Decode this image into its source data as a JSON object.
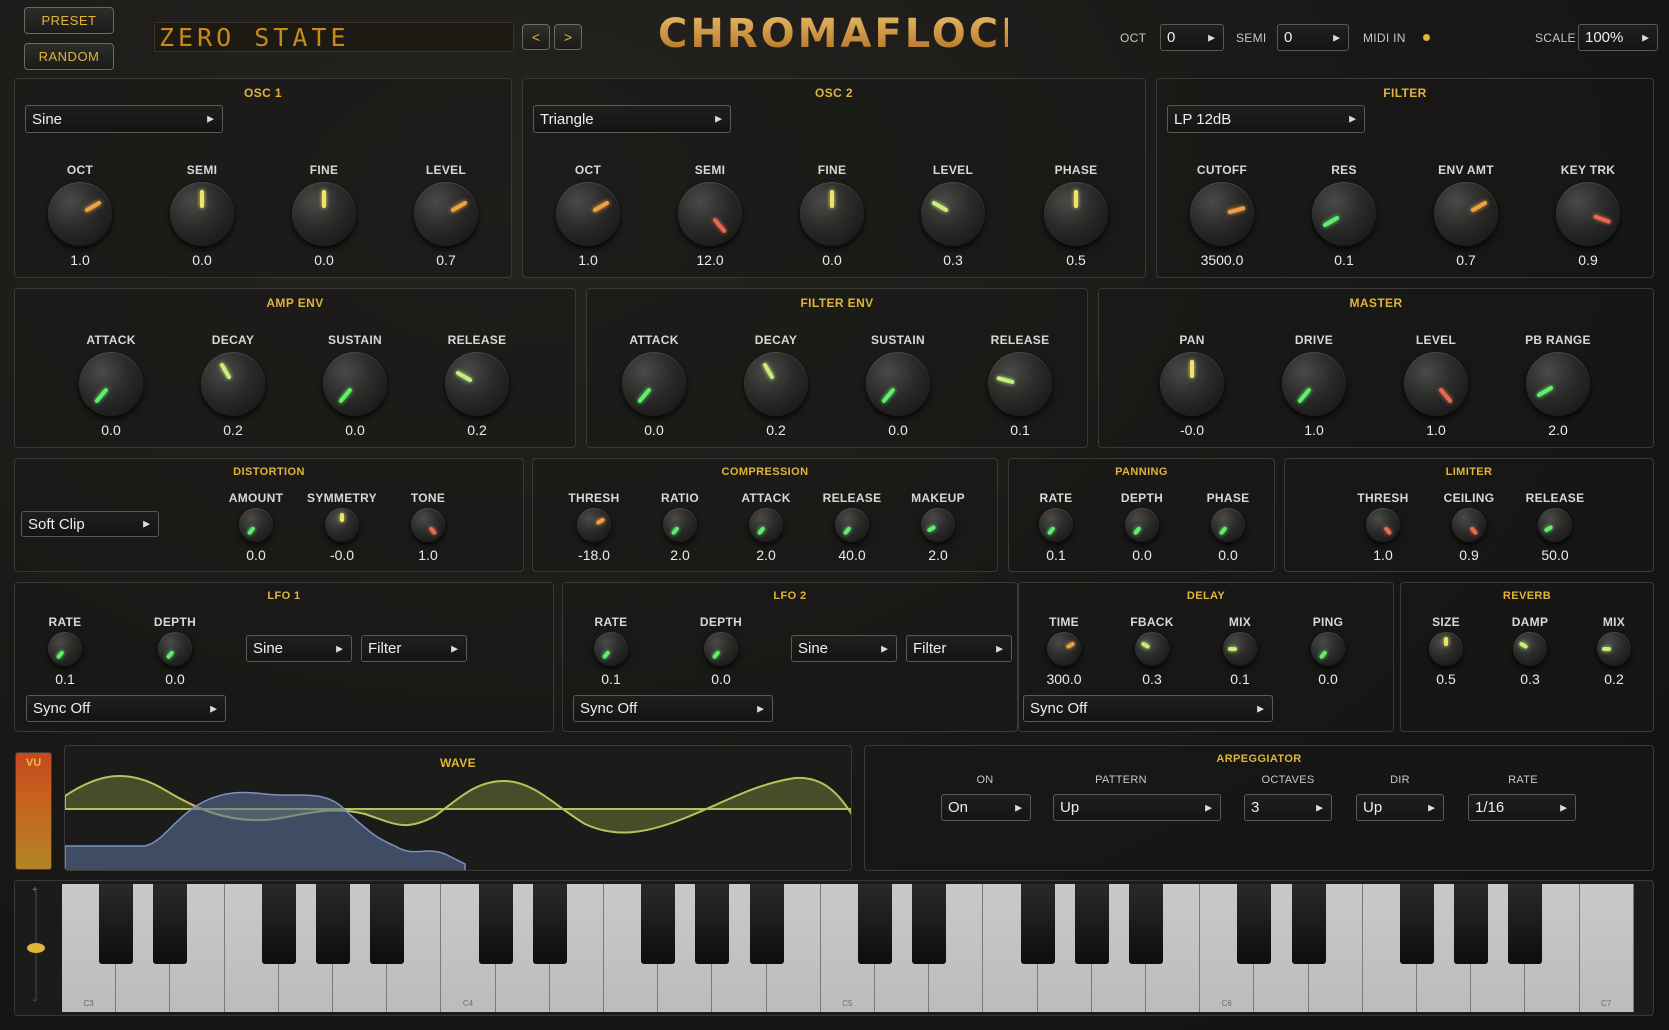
{
  "header": {
    "preset_label": "PRESET",
    "random_label": "RANDOM",
    "preset_name": "ZERO STATE",
    "prev_label": "<",
    "next_label": ">",
    "logo": "CHROMAFLOCK",
    "oct_label": "OCT",
    "oct_value": "0",
    "semi_label": "SEMI",
    "semi_value": "0",
    "midi_label": "MIDI IN",
    "scale_label": "SCALE",
    "scale_value": "100%"
  },
  "osc1": {
    "title": "OSC 1",
    "wave": "Sine",
    "knobs": [
      {
        "label": "OCT",
        "value": "1.0"
      },
      {
        "label": "SEMI",
        "value": "0.0"
      },
      {
        "label": "FINE",
        "value": "0.0"
      },
      {
        "label": "LEVEL",
        "value": "0.7"
      }
    ]
  },
  "osc2": {
    "title": "OSC 2",
    "wave": "Triangle",
    "knobs": [
      {
        "label": "OCT",
        "value": "1.0"
      },
      {
        "label": "SEMI",
        "value": "12.0"
      },
      {
        "label": "FINE",
        "value": "0.0"
      },
      {
        "label": "LEVEL",
        "value": "0.3"
      },
      {
        "label": "PHASE",
        "value": "0.5"
      }
    ]
  },
  "filter": {
    "title": "FILTER",
    "type": "LP 12dB",
    "knobs": [
      {
        "label": "CUTOFF",
        "value": "3500.0"
      },
      {
        "label": "RES",
        "value": "0.1"
      },
      {
        "label": "ENV AMT",
        "value": "0.7"
      },
      {
        "label": "KEY TRK",
        "value": "0.9"
      }
    ]
  },
  "ampenv": {
    "title": "AMP ENV",
    "knobs": [
      {
        "label": "ATTACK",
        "value": "0.0"
      },
      {
        "label": "DECAY",
        "value": "0.2"
      },
      {
        "label": "SUSTAIN",
        "value": "0.0"
      },
      {
        "label": "RELEASE",
        "value": "0.2"
      }
    ]
  },
  "filterenv": {
    "title": "FILTER ENV",
    "knobs": [
      {
        "label": "ATTACK",
        "value": "0.0"
      },
      {
        "label": "DECAY",
        "value": "0.2"
      },
      {
        "label": "SUSTAIN",
        "value": "0.0"
      },
      {
        "label": "RELEASE",
        "value": "0.1"
      }
    ]
  },
  "master": {
    "title": "MASTER",
    "knobs": [
      {
        "label": "PAN",
        "value": "-0.0"
      },
      {
        "label": "DRIVE",
        "value": "1.0"
      },
      {
        "label": "LEVEL",
        "value": "1.0"
      },
      {
        "label": "PB RANGE",
        "value": "2.0"
      }
    ]
  },
  "distortion": {
    "title": "DISTORTION",
    "type": "Soft Clip",
    "knobs": [
      {
        "label": "AMOUNT",
        "value": "0.0"
      },
      {
        "label": "SYMMETRY",
        "value": "-0.0"
      },
      {
        "label": "TONE",
        "value": "1.0"
      }
    ]
  },
  "compression": {
    "title": "COMPRESSION",
    "knobs": [
      {
        "label": "THRESH",
        "value": "-18.0"
      },
      {
        "label": "RATIO",
        "value": "2.0"
      },
      {
        "label": "ATTACK",
        "value": "2.0"
      },
      {
        "label": "RELEASE",
        "value": "40.0"
      },
      {
        "label": "MAKEUP",
        "value": "2.0"
      }
    ]
  },
  "panning": {
    "title": "PANNING",
    "knobs": [
      {
        "label": "RATE",
        "value": "0.1"
      },
      {
        "label": "DEPTH",
        "value": "0.0"
      },
      {
        "label": "PHASE",
        "value": "0.0"
      }
    ]
  },
  "limiter": {
    "title": "LIMITER",
    "knobs": [
      {
        "label": "THRESH",
        "value": "1.0"
      },
      {
        "label": "CEILING",
        "value": "0.9"
      },
      {
        "label": "RELEASE",
        "value": "50.0"
      }
    ]
  },
  "lfo1": {
    "title": "LFO 1",
    "wave": "Sine",
    "target": "Filter",
    "sync": "Sync Off",
    "knobs": [
      {
        "label": "RATE",
        "value": "0.1"
      },
      {
        "label": "DEPTH",
        "value": "0.0"
      }
    ]
  },
  "lfo2": {
    "title": "LFO 2",
    "wave": "Sine",
    "target": "Filter",
    "sync": "Sync Off",
    "knobs": [
      {
        "label": "RATE",
        "value": "0.1"
      },
      {
        "label": "DEPTH",
        "value": "0.0"
      }
    ]
  },
  "delay": {
    "title": "DELAY",
    "sync": "Sync Off",
    "knobs": [
      {
        "label": "TIME",
        "value": "300.0"
      },
      {
        "label": "FBACK",
        "value": "0.3"
      },
      {
        "label": "MIX",
        "value": "0.1"
      },
      {
        "label": "PING",
        "value": "0.0"
      }
    ]
  },
  "reverb": {
    "title": "REVERB",
    "knobs": [
      {
        "label": "SIZE",
        "value": "0.5"
      },
      {
        "label": "DAMP",
        "value": "0.3"
      },
      {
        "label": "MIX",
        "value": "0.2"
      }
    ]
  },
  "vu": {
    "label": "VU"
  },
  "wave": {
    "title": "WAVE"
  },
  "arp": {
    "title": "ARPEGGIATOR",
    "on_label": "ON",
    "on_value": "On",
    "pattern_label": "PATTERN",
    "pattern_value": "Up",
    "octaves_label": "OCTAVES",
    "octaves_value": "3",
    "dir_label": "DIR",
    "dir_value": "Up",
    "rate_label": "RATE",
    "rate_value": "1/16"
  },
  "keyboard": {
    "notes": [
      "C3",
      "C4",
      "C5",
      "C6",
      "C7"
    ],
    "plus": "+",
    "minus": "-"
  },
  "colors": {
    "accent": "#e0b53a",
    "knob_green": "#5ef06a",
    "knob_orange": "#f0a040",
    "knob_yellow": "#eee46a",
    "knob_red": "#e86a50",
    "knob_light_green": "#c6f07a"
  }
}
